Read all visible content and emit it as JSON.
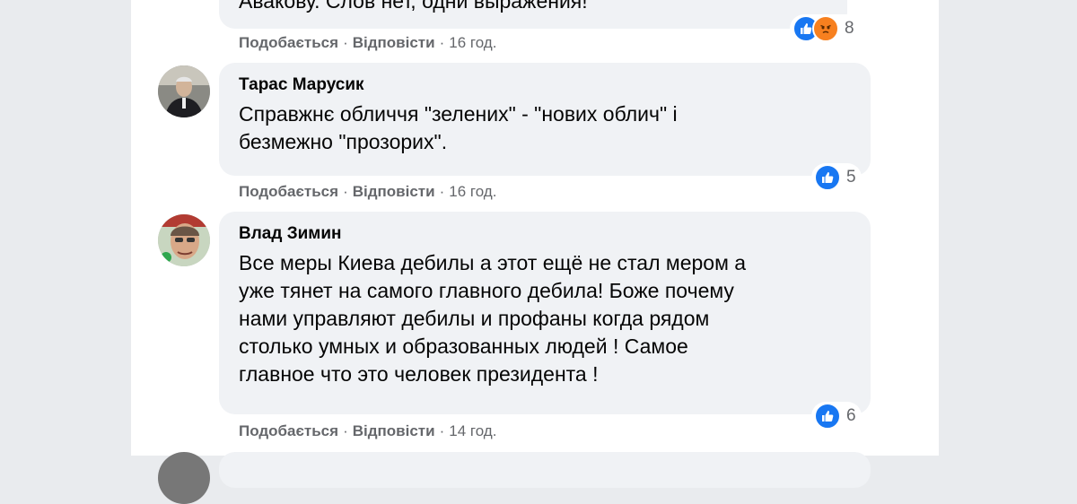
{
  "comments": [
    {
      "author": "",
      "text": "Авакову. Слов нет, одни выражения!",
      "reaction_count": "8",
      "time": "16 год."
    },
    {
      "author": "Тарас Марусик",
      "text": "Справжнє обличчя \"зелених\" - \"нових облич\" і\nбезмежно \"прозорих\".",
      "reaction_count": "5",
      "time": "16 год."
    },
    {
      "author": "Влад Зимин",
      "text": "Все меры Киева дебилы а этот ещё не стал мером а\nуже тянет на самого главного дебила! Боже почему\nнами управляют дебилы и профаны когда рядом\nстолько умных и образованных людей ! Самое\nглавное что это человек президента !",
      "reaction_count": "6",
      "time": "14 год."
    }
  ],
  "actions": {
    "like_label": "Подобається",
    "reply_label": "Відповісти",
    "separator": "·"
  },
  "colors": {
    "bubble": "#f0f2f5",
    "like_blue": "#1877f2",
    "angry_orange": "#f7801f",
    "meta_gray": "#65676b"
  },
  "icons": [
    "like-reaction-icon",
    "angry-reaction-icon"
  ]
}
